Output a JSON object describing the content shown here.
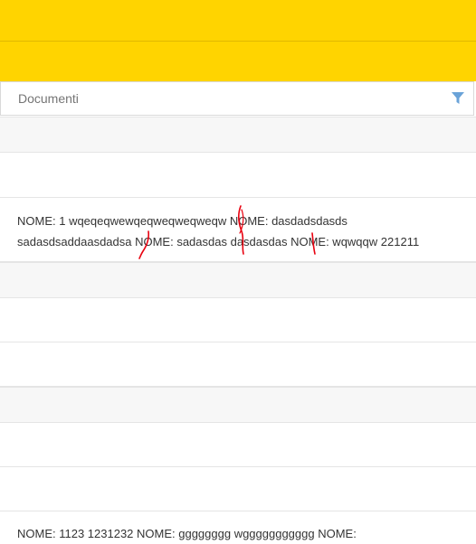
{
  "search": {
    "placeholder": "Documenti"
  },
  "icons": {
    "filter": "filter-icon"
  },
  "rows": [
    {
      "text": ""
    },
    {
      "text": "NOME: 1 wqeqeqwewqeqweqweqweqw NOME: dasdadsdasds sadasdsaddaasdadsa NOME: sadasdas dasdasdas NOME: wqwqqw 221211"
    },
    {
      "text": ""
    },
    {
      "text": ""
    },
    {
      "text": ""
    },
    {
      "text": ""
    },
    {
      "text": "NOME: 1123 1231232 NOME: gggggggg wggggggggggg NOME:"
    }
  ],
  "colors": {
    "accent": "#ffd400",
    "filter": "#6aa3d8",
    "annotation": "#e8000f"
  }
}
